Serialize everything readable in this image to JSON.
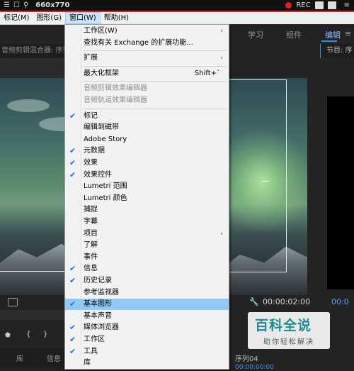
{
  "recorder": {
    "dimensions": "660x770",
    "rec_label": "REC"
  },
  "menubar": {
    "items": [
      "标记(M)",
      "图形(G)",
      "窗口(W)",
      "帮助(H)"
    ],
    "active_index": 2
  },
  "workspace_tabs": [
    "学习",
    "组件",
    "编辑"
  ],
  "left_panel_header": "音频剪辑混合器: 序列",
  "right_panel_header": "节目: 序",
  "window_menu": [
    {
      "label": "工作区(W)",
      "arrow": true
    },
    {
      "label": "查找有关 Exchange 的扩展功能..."
    },
    {
      "label": "扩展",
      "arrow": true
    },
    {
      "label": "最大化框架",
      "shortcut": "Shift+`"
    },
    {
      "label": "音频剪辑效果编辑器",
      "disabled": true
    },
    {
      "label": "音频轨道效果编辑器",
      "disabled": true
    },
    {
      "label": "标记",
      "checked": true
    },
    {
      "label": "编辑到磁带"
    },
    {
      "label": "Adobe Story"
    },
    {
      "label": "元数据",
      "checked": true
    },
    {
      "label": "效果",
      "checked": true
    },
    {
      "label": "效果控件",
      "checked": true
    },
    {
      "label": "Lumetri 范围"
    },
    {
      "label": "Lumetri 颜色"
    },
    {
      "label": "捕捉"
    },
    {
      "label": "字幕"
    },
    {
      "label": "项目",
      "arrow": true
    },
    {
      "label": "了解"
    },
    {
      "label": "事件"
    },
    {
      "label": "信息",
      "checked": true
    },
    {
      "label": "历史记录",
      "checked": true
    },
    {
      "label": "参考监视器"
    },
    {
      "label": "基本图形",
      "checked": true,
      "highlighted": true
    },
    {
      "label": "基本声音"
    },
    {
      "label": "媒体浏览器",
      "checked": true
    },
    {
      "label": "工作区",
      "checked": true
    },
    {
      "label": "工具",
      "checked": true
    },
    {
      "label": "库"
    }
  ],
  "program_monitor": {
    "timecode": "00:00:02:00",
    "timecode_right": "00:0"
  },
  "bottom": {
    "tab_library": "库",
    "tab_info": "信息",
    "sequence": "序列04",
    "sequence_timecode": "00:00:00:00"
  },
  "watermark": {
    "title": "百科全说",
    "subtitle": "助你轻松解决"
  },
  "colors": {
    "highlight": "#91c9f7",
    "check": "#1a73d8",
    "accent_blue": "#3d8cf0",
    "rec_red": "#e02020"
  }
}
